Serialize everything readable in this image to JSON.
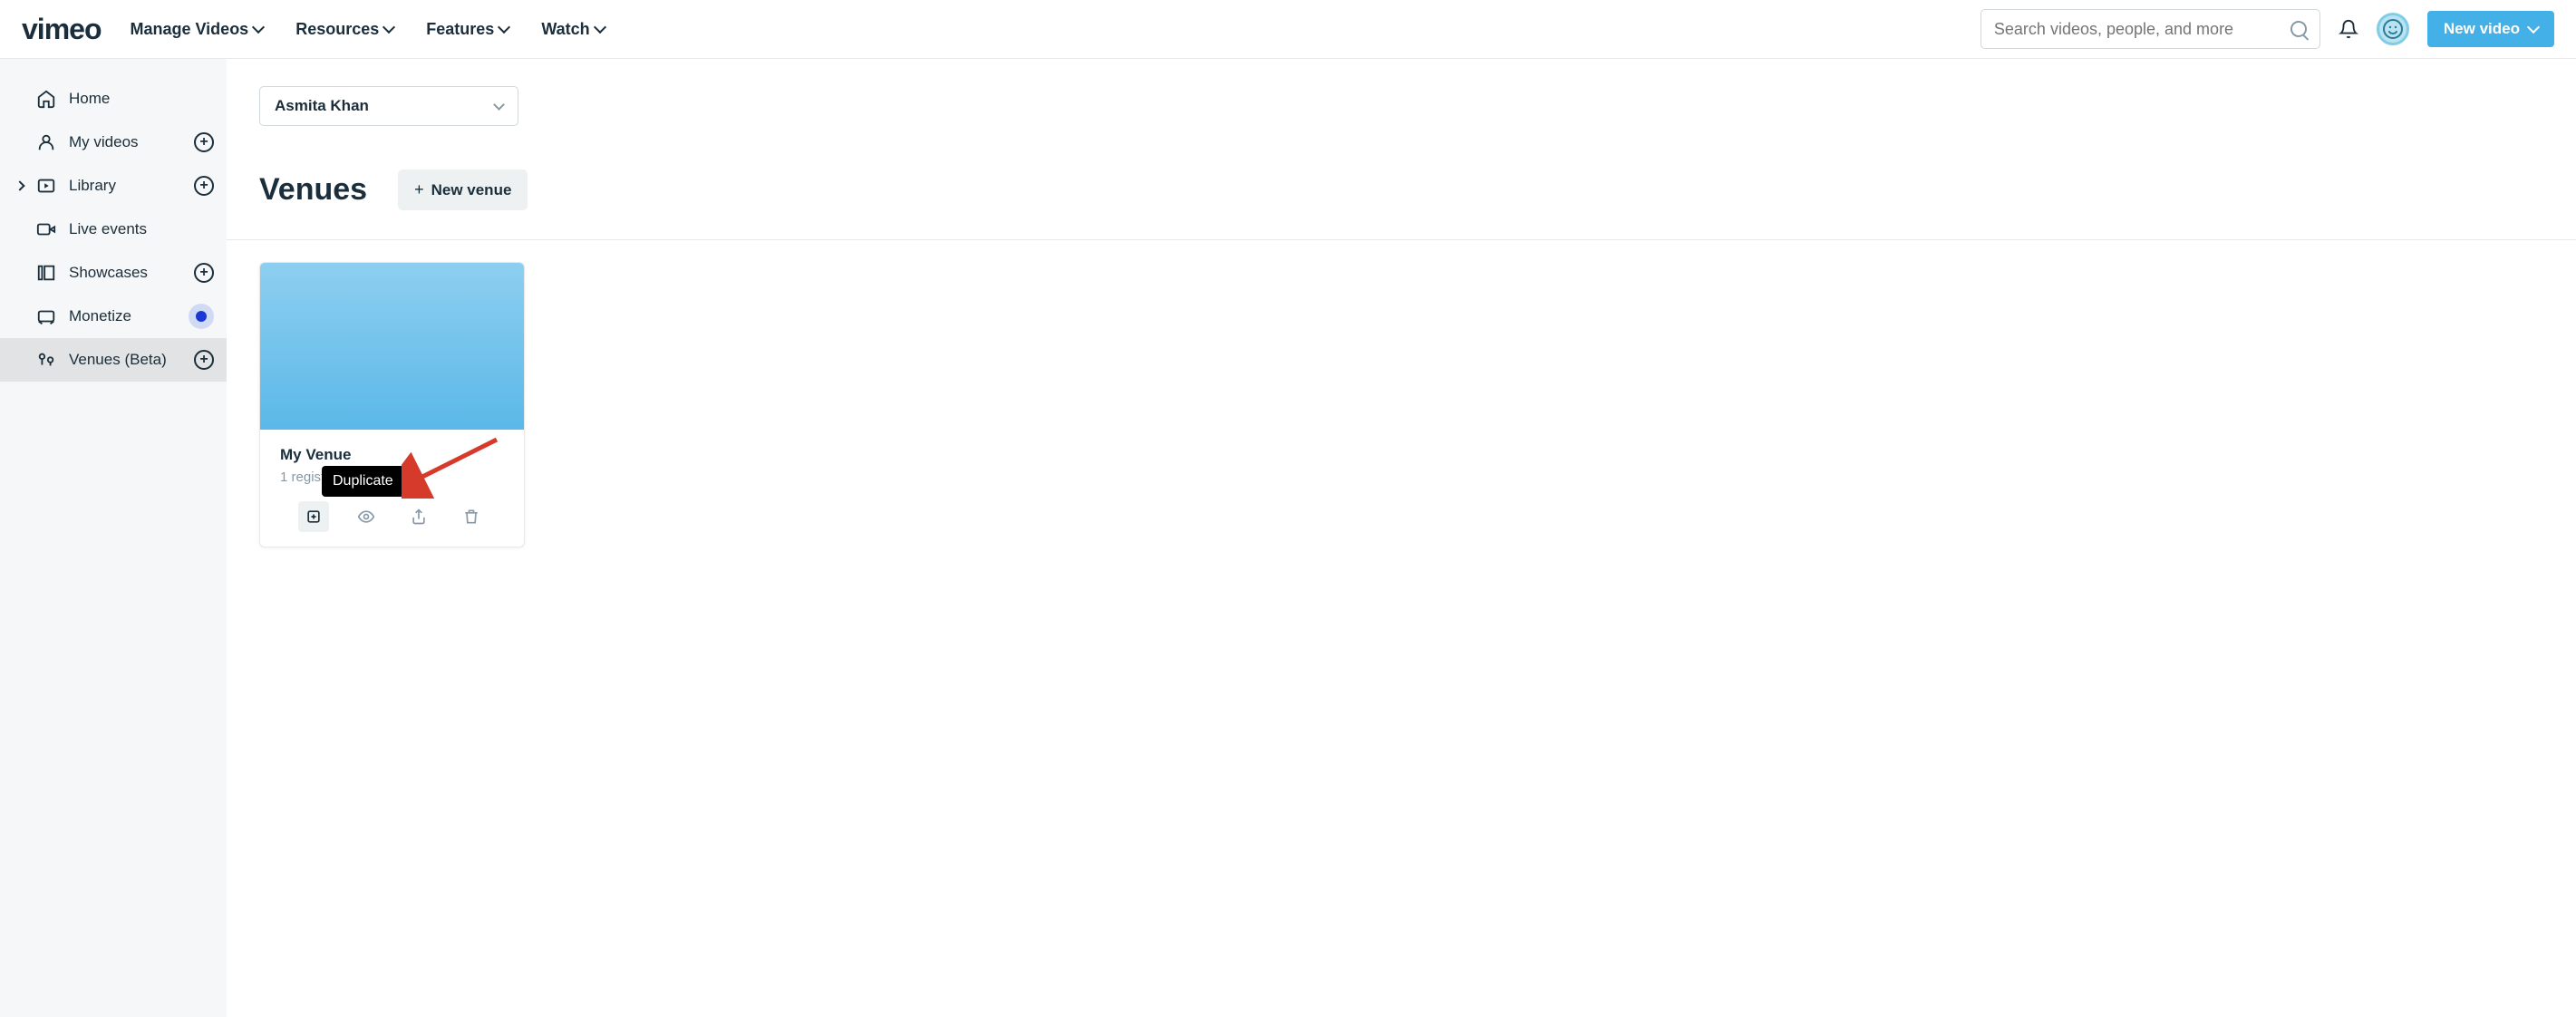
{
  "header": {
    "logo": "vimeo",
    "nav": [
      {
        "label": "Manage Videos"
      },
      {
        "label": "Resources"
      },
      {
        "label": "Features"
      },
      {
        "label": "Watch"
      }
    ],
    "search_placeholder": "Search videos, people, and more",
    "new_video_label": "New video"
  },
  "sidebar": {
    "items": [
      {
        "label": "Home",
        "icon": "home",
        "has_add": false
      },
      {
        "label": "My videos",
        "icon": "user",
        "has_add": true
      },
      {
        "label": "Library",
        "icon": "library",
        "has_add": true,
        "expandable": true
      },
      {
        "label": "Live events",
        "icon": "live"
      },
      {
        "label": "Showcases",
        "icon": "showcases",
        "has_add": true
      },
      {
        "label": "Monetize",
        "icon": "monetize",
        "has_dot": true
      },
      {
        "label": "Venues (Beta)",
        "icon": "venues",
        "has_add": true,
        "active": true
      }
    ]
  },
  "main": {
    "user_selector": "Asmita Khan",
    "page_title": "Venues",
    "new_venue_label": "New venue",
    "venue": {
      "title": "My Venue",
      "subtitle": "1 regist",
      "tooltip": "Duplicate"
    }
  },
  "colors": {
    "accent": "#44b0e8",
    "brand_blue": "#1937d6"
  }
}
